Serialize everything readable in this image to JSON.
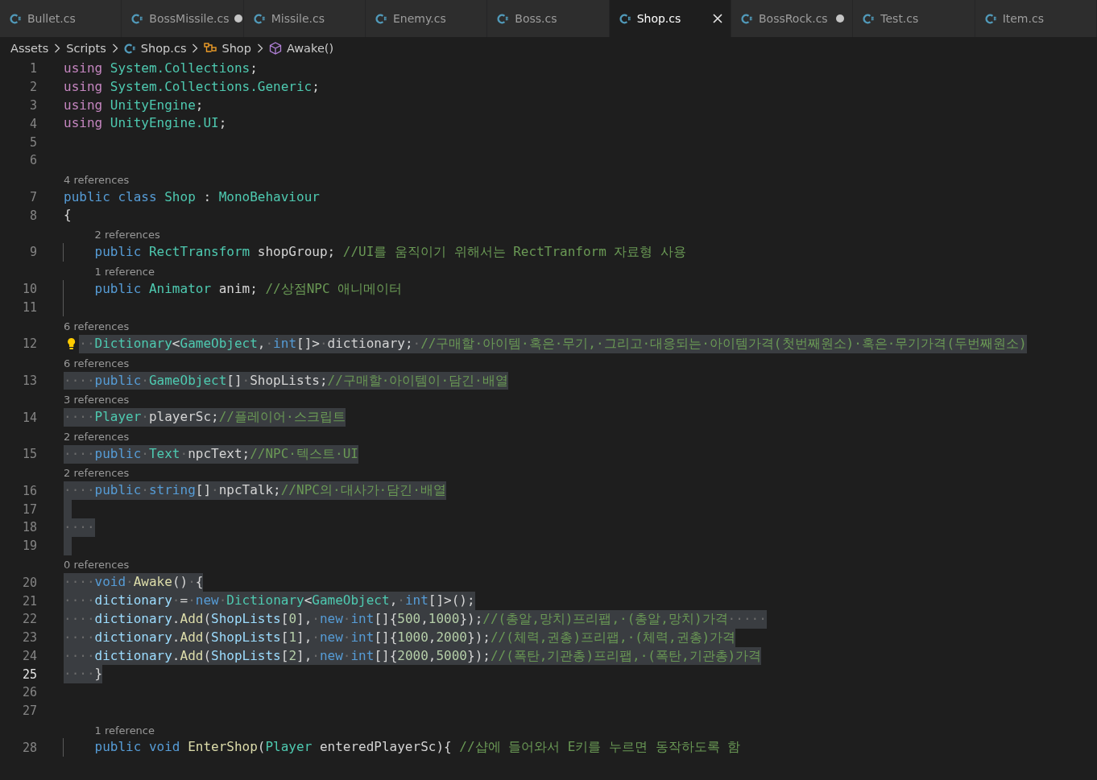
{
  "tabs": [
    {
      "label": "Bullet.cs",
      "selected": false,
      "modified": false
    },
    {
      "label": "BossMissile.cs",
      "selected": false,
      "modified": true
    },
    {
      "label": "Missile.cs",
      "selected": false,
      "modified": false
    },
    {
      "label": "Enemy.cs",
      "selected": false,
      "modified": false
    },
    {
      "label": "Boss.cs",
      "selected": false,
      "modified": false
    },
    {
      "label": "Shop.cs",
      "selected": true,
      "modified": false
    },
    {
      "label": "BossRock.cs",
      "selected": false,
      "modified": true
    },
    {
      "label": "Test.cs",
      "selected": false,
      "modified": false
    },
    {
      "label": "Item.cs",
      "selected": false,
      "modified": false
    }
  ],
  "breadcrumb": [
    {
      "label": "Assets",
      "kind": "folder"
    },
    {
      "label": "Scripts",
      "kind": "folder"
    },
    {
      "label": "Shop.cs",
      "kind": "file"
    },
    {
      "label": "Shop",
      "kind": "class"
    },
    {
      "label": "Awake()",
      "kind": "method"
    }
  ],
  "editor": {
    "lines": [
      {
        "number": "1",
        "selected": false,
        "current": false,
        "indented": false,
        "tokens": [
          {
            "kind": "control",
            "text": "using "
          },
          {
            "kind": "type",
            "text": "System.Collections"
          },
          {
            "kind": "plain",
            "text": ";"
          }
        ]
      },
      {
        "number": "2",
        "selected": false,
        "current": false,
        "indented": false,
        "tokens": [
          {
            "kind": "control",
            "text": "using "
          },
          {
            "kind": "type",
            "text": "System.Collections.Generic"
          },
          {
            "kind": "plain",
            "text": ";"
          }
        ]
      },
      {
        "number": "3",
        "selected": false,
        "current": false,
        "indented": false,
        "tokens": [
          {
            "kind": "control",
            "text": "using "
          },
          {
            "kind": "type",
            "text": "UnityEngine"
          },
          {
            "kind": "plain",
            "text": ";"
          }
        ]
      },
      {
        "number": "4",
        "selected": false,
        "current": false,
        "indented": false,
        "tokens": [
          {
            "kind": "control",
            "text": "using "
          },
          {
            "kind": "type",
            "text": "UnityEngine.UI"
          },
          {
            "kind": "plain",
            "text": ";"
          }
        ]
      },
      {
        "number": "5",
        "selected": false,
        "current": false,
        "indented": false
      },
      {
        "number": "6",
        "selected": false,
        "current": false,
        "indented": false
      },
      {
        "number": "7",
        "selected": false,
        "current": false,
        "indented": false,
        "references": "4 references",
        "tokens": [
          {
            "kind": "keyword",
            "text": "public class "
          },
          {
            "kind": "type",
            "text": "Shop"
          },
          {
            "kind": "plain",
            "text": " : "
          },
          {
            "kind": "type",
            "text": "MonoBehaviour"
          }
        ]
      },
      {
        "number": "8",
        "selected": false,
        "current": false,
        "indented": false,
        "tokens": [
          {
            "kind": "plain",
            "text": "{"
          }
        ]
      },
      {
        "number": "9",
        "selected": false,
        "current": false,
        "indented": true,
        "references": "2 references",
        "tokens": [
          {
            "kind": "keyword",
            "text": "public "
          },
          {
            "kind": "type",
            "text": "RectTransform"
          },
          {
            "kind": "plain",
            "text": " shopGroup; "
          },
          {
            "kind": "comment",
            "text": "//UI를 움직이기 위해서는 RectTranform 자료형 사용"
          }
        ]
      },
      {
        "number": "10",
        "selected": false,
        "current": false,
        "indented": true,
        "references": "1 reference",
        "tokens": [
          {
            "kind": "keyword",
            "text": "public "
          },
          {
            "kind": "type",
            "text": "Animator"
          },
          {
            "kind": "plain",
            "text": " anim; "
          },
          {
            "kind": "comment",
            "text": "//상점NPC 애니메이터"
          }
        ]
      },
      {
        "number": "11",
        "selected": false,
        "current": false,
        "indented": true
      },
      {
        "number": "12",
        "selected": true,
        "current": false,
        "indented": false,
        "lightbulb": true,
        "references": "6 references",
        "tokens": [
          {
            "kind": "whitespace",
            "text": "··"
          },
          {
            "kind": "type",
            "text": "Dictionary"
          },
          {
            "kind": "plain",
            "text": "<"
          },
          {
            "kind": "type",
            "text": "GameObject"
          },
          {
            "kind": "plain",
            "text": ","
          },
          {
            "kind": "whitespace",
            "text": "·"
          },
          {
            "kind": "keyword",
            "text": "int"
          },
          {
            "kind": "plain",
            "text": "[]>"
          },
          {
            "kind": "whitespace",
            "text": "·"
          },
          {
            "kind": "plain",
            "text": "dictionary;"
          },
          {
            "kind": "whitespace",
            "text": "·"
          },
          {
            "kind": "comment",
            "text": "//구매할·아이템·혹은·무기,·그리고·대응되는·아이템가격(첫번째원소)·혹은·무기가격(두번째원소)"
          }
        ]
      },
      {
        "number": "13",
        "selected": true,
        "current": false,
        "indented": false,
        "references": "6 references",
        "tokens": [
          {
            "kind": "whitespace",
            "text": "····"
          },
          {
            "kind": "keyword",
            "text": "public"
          },
          {
            "kind": "whitespace",
            "text": "·"
          },
          {
            "kind": "type",
            "text": "GameObject"
          },
          {
            "kind": "plain",
            "text": "[]"
          },
          {
            "kind": "whitespace",
            "text": "·"
          },
          {
            "kind": "plain",
            "text": "ShopLists;"
          },
          {
            "kind": "comment",
            "text": "//구매할·아이템이·담긴·배열"
          }
        ]
      },
      {
        "number": "14",
        "selected": true,
        "current": false,
        "indented": false,
        "references": "3 references",
        "tokens": [
          {
            "kind": "whitespace",
            "text": "····"
          },
          {
            "kind": "type",
            "text": "Player"
          },
          {
            "kind": "whitespace",
            "text": "·"
          },
          {
            "kind": "plain",
            "text": "playerSc;"
          },
          {
            "kind": "comment",
            "text": "//플레이어·스크립트"
          }
        ]
      },
      {
        "number": "15",
        "selected": true,
        "current": false,
        "indented": false,
        "references": "2 references",
        "tokens": [
          {
            "kind": "whitespace",
            "text": "····"
          },
          {
            "kind": "keyword",
            "text": "public"
          },
          {
            "kind": "whitespace",
            "text": "·"
          },
          {
            "kind": "type",
            "text": "Text"
          },
          {
            "kind": "whitespace",
            "text": "·"
          },
          {
            "kind": "plain",
            "text": "npcText;"
          },
          {
            "kind": "comment",
            "text": "//NPC·텍스트·UI"
          }
        ]
      },
      {
        "number": "16",
        "selected": true,
        "current": false,
        "indented": false,
        "references": "2 references",
        "tokens": [
          {
            "kind": "whitespace",
            "text": "····"
          },
          {
            "kind": "keyword",
            "text": "public"
          },
          {
            "kind": "whitespace",
            "text": "·"
          },
          {
            "kind": "keyword",
            "text": "string"
          },
          {
            "kind": "plain",
            "text": "[]"
          },
          {
            "kind": "whitespace",
            "text": "·"
          },
          {
            "kind": "plain",
            "text": "npcTalk;"
          },
          {
            "kind": "comment",
            "text": "//NPC의·대사가·담긴·배열"
          }
        ]
      },
      {
        "number": "17",
        "selected": true,
        "current": false,
        "indented": false
      },
      {
        "number": "18",
        "selected": true,
        "current": false,
        "indented": false,
        "tokens": [
          {
            "kind": "whitespace",
            "text": "····"
          }
        ]
      },
      {
        "number": "19",
        "selected": true,
        "current": false,
        "indented": false
      },
      {
        "number": "20",
        "selected": true,
        "current": false,
        "indented": false,
        "references": "0 references",
        "tokens": [
          {
            "kind": "whitespace",
            "text": "····"
          },
          {
            "kind": "keyword",
            "text": "void"
          },
          {
            "kind": "whitespace",
            "text": "·"
          },
          {
            "kind": "function",
            "text": "Awake"
          },
          {
            "kind": "plain",
            "text": "()"
          },
          {
            "kind": "whitespace",
            "text": "·"
          },
          {
            "kind": "plain",
            "text": "{"
          }
        ]
      },
      {
        "number": "21",
        "selected": true,
        "current": false,
        "indented": false,
        "tokens": [
          {
            "kind": "whitespace",
            "text": "····"
          },
          {
            "kind": "variable",
            "text": "dictionary"
          },
          {
            "kind": "whitespace",
            "text": "·"
          },
          {
            "kind": "plain",
            "text": "="
          },
          {
            "kind": "whitespace",
            "text": "·"
          },
          {
            "kind": "keyword",
            "text": "new"
          },
          {
            "kind": "whitespace",
            "text": "·"
          },
          {
            "kind": "type",
            "text": "Dictionary"
          },
          {
            "kind": "plain",
            "text": "<"
          },
          {
            "kind": "type",
            "text": "GameObject"
          },
          {
            "kind": "plain",
            "text": ","
          },
          {
            "kind": "whitespace",
            "text": "·"
          },
          {
            "kind": "keyword",
            "text": "int"
          },
          {
            "kind": "plain",
            "text": "[]>();"
          }
        ]
      },
      {
        "number": "22",
        "selected": true,
        "current": false,
        "indented": false,
        "tokens": [
          {
            "kind": "whitespace",
            "text": "····"
          },
          {
            "kind": "variable",
            "text": "dictionary"
          },
          {
            "kind": "plain",
            "text": "."
          },
          {
            "kind": "function",
            "text": "Add"
          },
          {
            "kind": "plain",
            "text": "("
          },
          {
            "kind": "variable",
            "text": "ShopLists"
          },
          {
            "kind": "plain",
            "text": "["
          },
          {
            "kind": "number",
            "text": "0"
          },
          {
            "kind": "plain",
            "text": "],"
          },
          {
            "kind": "whitespace",
            "text": "·"
          },
          {
            "kind": "keyword",
            "text": "new"
          },
          {
            "kind": "whitespace",
            "text": "·"
          },
          {
            "kind": "keyword",
            "text": "int"
          },
          {
            "kind": "plain",
            "text": "[]{"
          },
          {
            "kind": "number",
            "text": "500"
          },
          {
            "kind": "plain",
            "text": ","
          },
          {
            "kind": "number",
            "text": "1000"
          },
          {
            "kind": "plain",
            "text": "});"
          },
          {
            "kind": "comment",
            "text": "//(총알,망치)프리팹,·(총알,망치)가격"
          },
          {
            "kind": "whitespace",
            "text": "·····"
          }
        ]
      },
      {
        "number": "23",
        "selected": true,
        "current": false,
        "indented": false,
        "tokens": [
          {
            "kind": "whitespace",
            "text": "····"
          },
          {
            "kind": "variable",
            "text": "dictionary"
          },
          {
            "kind": "plain",
            "text": "."
          },
          {
            "kind": "function",
            "text": "Add"
          },
          {
            "kind": "plain",
            "text": "("
          },
          {
            "kind": "variable",
            "text": "ShopLists"
          },
          {
            "kind": "plain",
            "text": "["
          },
          {
            "kind": "number",
            "text": "1"
          },
          {
            "kind": "plain",
            "text": "],"
          },
          {
            "kind": "whitespace",
            "text": "·"
          },
          {
            "kind": "keyword",
            "text": "new"
          },
          {
            "kind": "whitespace",
            "text": "·"
          },
          {
            "kind": "keyword",
            "text": "int"
          },
          {
            "kind": "plain",
            "text": "[]{"
          },
          {
            "kind": "number",
            "text": "1000"
          },
          {
            "kind": "plain",
            "text": ","
          },
          {
            "kind": "number",
            "text": "2000"
          },
          {
            "kind": "plain",
            "text": "});"
          },
          {
            "kind": "comment",
            "text": "//(체력,권총)프리팹,·(체력,권총)가격"
          }
        ]
      },
      {
        "number": "24",
        "selected": true,
        "current": false,
        "indented": false,
        "tokens": [
          {
            "kind": "whitespace",
            "text": "····"
          },
          {
            "kind": "variable",
            "text": "dictionary"
          },
          {
            "kind": "plain",
            "text": "."
          },
          {
            "kind": "function",
            "text": "Add"
          },
          {
            "kind": "plain",
            "text": "("
          },
          {
            "kind": "variable",
            "text": "ShopLists"
          },
          {
            "kind": "plain",
            "text": "["
          },
          {
            "kind": "number",
            "text": "2"
          },
          {
            "kind": "plain",
            "text": "],"
          },
          {
            "kind": "whitespace",
            "text": "·"
          },
          {
            "kind": "keyword",
            "text": "new"
          },
          {
            "kind": "whitespace",
            "text": "·"
          },
          {
            "kind": "keyword",
            "text": "int"
          },
          {
            "kind": "plain",
            "text": "[]{"
          },
          {
            "kind": "number",
            "text": "2000"
          },
          {
            "kind": "plain",
            "text": ","
          },
          {
            "kind": "number",
            "text": "5000"
          },
          {
            "kind": "plain",
            "text": "});"
          },
          {
            "kind": "comment",
            "text": "//(폭탄,기관총)프리팹,·(폭탄,기관총)가격"
          }
        ]
      },
      {
        "number": "25",
        "selected": true,
        "current": true,
        "indented": false,
        "tokens": [
          {
            "kind": "whitespace",
            "text": "····"
          },
          {
            "kind": "plain",
            "text": "}"
          }
        ]
      },
      {
        "number": "26",
        "selected": false,
        "current": false,
        "indented": false
      },
      {
        "number": "27",
        "selected": false,
        "current": false,
        "indented": false
      },
      {
        "number": "28",
        "selected": false,
        "current": false,
        "indented": true,
        "references": "1 reference",
        "tokens": [
          {
            "kind": "keyword",
            "text": "public void "
          },
          {
            "kind": "function",
            "text": "EnterShop"
          },
          {
            "kind": "plain",
            "text": "("
          },
          {
            "kind": "type",
            "text": "Player"
          },
          {
            "kind": "plain",
            "text": " enteredPlayerSc){ "
          },
          {
            "kind": "comment",
            "text": "//샵에 들어와서 E키를 누르면 동작하도록 함"
          }
        ]
      }
    ]
  }
}
